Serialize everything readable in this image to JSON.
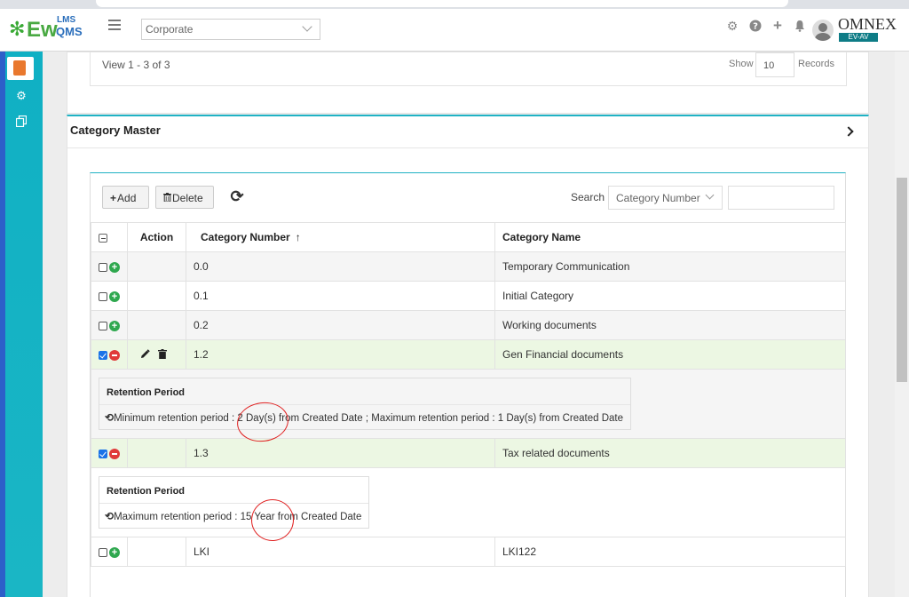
{
  "header": {
    "logo": "EwLMSQMS",
    "logo_main": "Ew",
    "logo_lms": "LMS",
    "logo_qms": "QMS",
    "org_select": "Corporate",
    "brand": "OMNEX",
    "brand_badge": "EV-AV"
  },
  "pager": {
    "view_text": "View 1 - 3 of 3",
    "show_label": "Show",
    "page_size": "10",
    "records_label": "Records"
  },
  "category_master": {
    "title": "Category Master",
    "toolbar": {
      "add_label": "Add",
      "delete_label": "Delete",
      "search_label": "Search",
      "search_field": "Category Number"
    },
    "columns": {
      "action": "Action",
      "category_number": "Category Number",
      "category_name": "Category Name"
    },
    "rows": [
      {
        "number": "0.0",
        "name": "Temporary Communication"
      },
      {
        "number": "0.1",
        "name": "Initial Category"
      },
      {
        "number": "0.2",
        "name": "Working documents"
      },
      {
        "number": "1.2",
        "name": "Gen Financial documents"
      },
      {
        "number": "1.3",
        "name": "Tax related documents"
      },
      {
        "number": "LKI",
        "name": "LKI122"
      }
    ],
    "retention": [
      {
        "title": "Retention Period",
        "text": "Minimum retention period : 2 Day(s) from Created Date ; Maximum retention period : 1 Day(s) from Created Date"
      },
      {
        "title": "Retention Period",
        "text": "Maximum retention period : 15 Year from Created Date"
      }
    ]
  },
  "colors": {
    "rail": "#10b0c4",
    "accent": "#20b2c4",
    "selected_row": "#ecf7e3",
    "add_icon": "#2fa84f",
    "remove_icon": "#e03a3a",
    "annotation": "#e02020"
  }
}
